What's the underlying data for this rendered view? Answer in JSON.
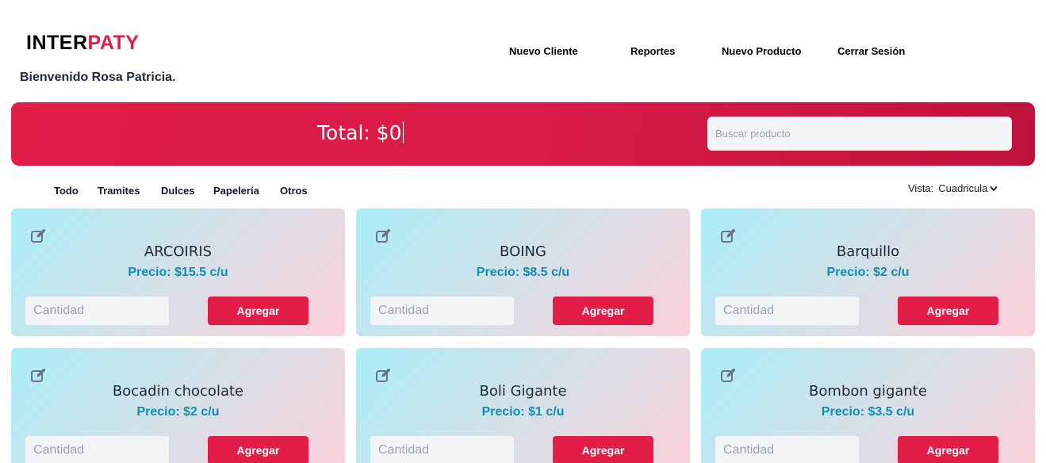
{
  "brand": {
    "part1": "INTER",
    "part2": "PATY"
  },
  "welcome": "Bienvenido Rosa Patricia.",
  "nav": [
    "Nuevo Cliente",
    "Reportes",
    "Nuevo Producto",
    "Cerrar Sesión"
  ],
  "banner": {
    "total": "Total: $0",
    "search_placeholder": "Buscar producto"
  },
  "filters": [
    "Todo",
    "Tramites",
    "Dulces",
    "Papelería",
    "Otros"
  ],
  "view": {
    "label": "Vista:",
    "selected": "Cuadricula"
  },
  "products": [
    {
      "name": "ARCOIRIS",
      "price": "Precio: $15.5 c/u",
      "qty_placeholder": "Cantidad",
      "button": "Agregar"
    },
    {
      "name": "BOING",
      "price": "Precio: $8.5 c/u",
      "qty_placeholder": "Cantidad",
      "button": "Agregar"
    },
    {
      "name": "Barquillo",
      "price": "Precio: $2 c/u",
      "qty_placeholder": "Cantidad",
      "button": "Agregar"
    },
    {
      "name": "Bocadin chocolate",
      "price": "Precio: $2 c/u",
      "qty_placeholder": "Cantidad",
      "button": "Agregar"
    },
    {
      "name": "Boli Gigante",
      "price": "Precio: $1 c/u",
      "qty_placeholder": "Cantidad",
      "button": "Agregar"
    },
    {
      "name": "Bombon gigante",
      "price": "Precio: $3.5 c/u",
      "qty_placeholder": "Cantidad",
      "button": "Agregar"
    }
  ],
  "colors": {
    "accent": "#e11d48",
    "price": "#0e8fb3",
    "card_from": "#a9eef8",
    "card_to": "#fcd0d8"
  },
  "icons": {
    "edit": "edit-icon",
    "dropdown": "chevron-down-icon"
  }
}
